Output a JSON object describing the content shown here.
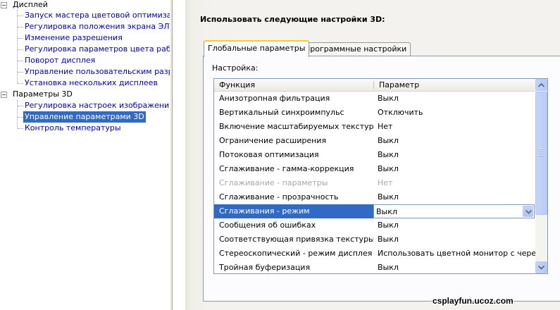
{
  "tree": {
    "display": {
      "label": "Дисплей",
      "items": [
        {
          "label": "Запуск мастера цветовой оптимизации"
        },
        {
          "label": "Регулировка положения экрана ЭЛТ"
        },
        {
          "label": "Изменение разрешения"
        },
        {
          "label": "Регулировка параметров цвета рабочего стола"
        },
        {
          "label": "Поворот дисплея"
        },
        {
          "label": "Управление пользовательским разрешением"
        },
        {
          "label": "Установка нескольких дисплеев"
        }
      ]
    },
    "settings3d": {
      "label": "Параметры 3D",
      "items": [
        {
          "label": "Регулировка настроек изображения с просмотром"
        },
        {
          "label": "Управление параметрами 3D",
          "selected": true
        },
        {
          "label": "Контроль температуры"
        }
      ]
    }
  },
  "panel": {
    "heading": "Использовать следующие настройки 3D:",
    "tabs": [
      {
        "label": "Глобальные параметры",
        "active": true
      },
      {
        "label": "Программные настройки",
        "active": false
      }
    ],
    "setting_label": "Настройка:",
    "columns": {
      "function": "Функция",
      "parameter": "Параметр"
    },
    "rows": [
      {
        "function": "Анизотропная фильтрация",
        "parameter": "Выкл"
      },
      {
        "function": "Вертикальный синхроимпульс",
        "parameter": "Отключить"
      },
      {
        "function": "Включение масштабируемых текстур",
        "parameter": "Нет"
      },
      {
        "function": "Ограничение расширения",
        "parameter": "Выкл"
      },
      {
        "function": "Потоковая оптимизация",
        "parameter": "Выкл"
      },
      {
        "function": "Сглаживание - гамма-коррекция",
        "parameter": "Выкл"
      },
      {
        "function": "Сглаживание - параметры",
        "parameter": "Нет",
        "disabled": true
      },
      {
        "function": "Сглаживание - прозрачность",
        "parameter": "Выкл"
      },
      {
        "function": "Сглаживания - режим",
        "parameter": "Выкл",
        "selected": true
      },
      {
        "function": "Сообщения об ошибках",
        "parameter": "Выкл"
      },
      {
        "function": "Соответствующая привязка текстуры",
        "parameter": "Выкл"
      },
      {
        "function": "Стереоскопический - режим дисплея",
        "parameter": "Использовать цветной монитор с чересстрочной разверткой"
      },
      {
        "function": "Тройная буферизация",
        "parameter": "Выкл"
      }
    ]
  },
  "watermark": "csplayfun.ucoz.com",
  "colors": {
    "selection": "#316ac5",
    "active_tab_accent": "#ffc83c",
    "link": "#0000cc"
  }
}
